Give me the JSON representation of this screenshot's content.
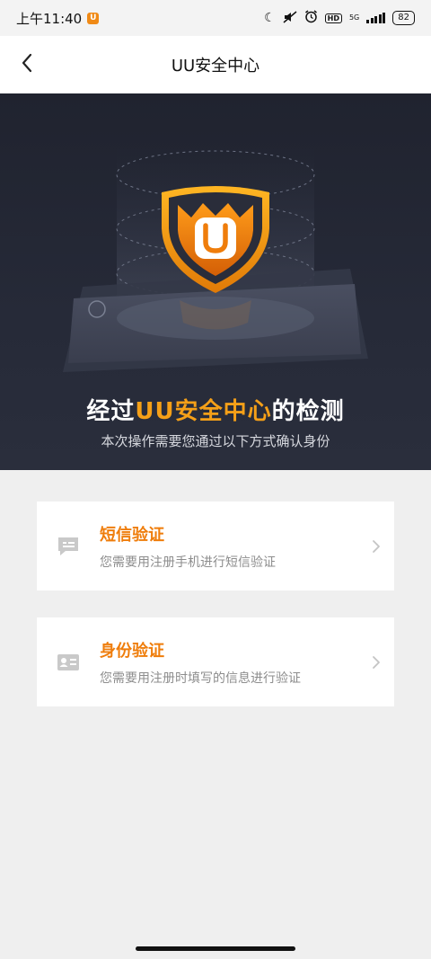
{
  "status_bar": {
    "time": "上午11:40",
    "app_badge": "U",
    "network": "5G",
    "battery": "82",
    "hd": "HD",
    "icons": [
      "moon-icon",
      "mute-icon",
      "alarm-icon",
      "hd-icon",
      "signal-icon",
      "battery-icon"
    ]
  },
  "nav": {
    "title": "UU安全中心",
    "back_icon": "chevron-left-icon"
  },
  "hero": {
    "title_prefix": "经过",
    "title_accent": "UU安全中心",
    "title_suffix": "的检测",
    "subtitle": "本次操作需要您通过以下方式确认身份",
    "shield_letter": "U",
    "accent_color": "#f5a018"
  },
  "options": [
    {
      "title": "短信验证",
      "desc": "您需要用注册手机进行短信验证",
      "icon": "message-icon"
    },
    {
      "title": "身份验证",
      "desc": "您需要用注册时填写的信息进行验证",
      "icon": "id-card-icon"
    }
  ],
  "colors": {
    "brand_orange": "#ef7d0b",
    "hero_bg": "#232633",
    "page_bg": "#efefef"
  }
}
